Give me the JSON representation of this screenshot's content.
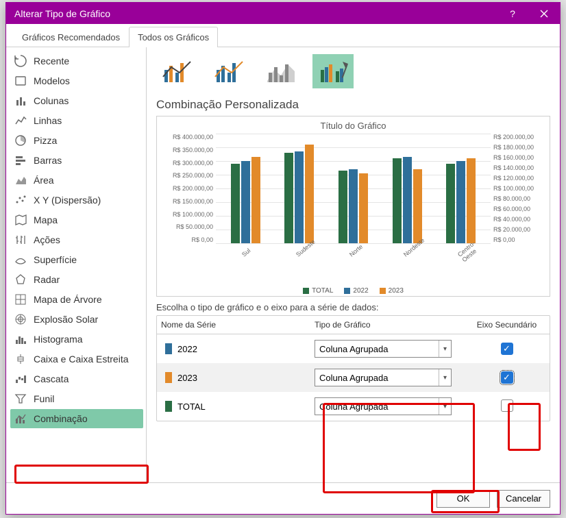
{
  "window": {
    "title": "Alterar Tipo de Gráfico"
  },
  "tabs": [
    {
      "label": "Gráficos Recomendados",
      "selected": false
    },
    {
      "label": "Todos os Gráficos",
      "selected": true
    }
  ],
  "sidebar": {
    "items": [
      {
        "label": "Recente",
        "icon": "recent"
      },
      {
        "label": "Modelos",
        "icon": "template"
      },
      {
        "label": "Colunas",
        "icon": "column"
      },
      {
        "label": "Linhas",
        "icon": "line"
      },
      {
        "label": "Pizza",
        "icon": "pie"
      },
      {
        "label": "Barras",
        "icon": "bar"
      },
      {
        "label": "Área",
        "icon": "area"
      },
      {
        "label": "X Y (Dispersão)",
        "icon": "scatter"
      },
      {
        "label": "Mapa",
        "icon": "map"
      },
      {
        "label": "Ações",
        "icon": "stock"
      },
      {
        "label": "Superfície",
        "icon": "surface"
      },
      {
        "label": "Radar",
        "icon": "radar"
      },
      {
        "label": "Mapa de Árvore",
        "icon": "treemap"
      },
      {
        "label": "Explosão Solar",
        "icon": "sunburst"
      },
      {
        "label": "Histograma",
        "icon": "histogram"
      },
      {
        "label": "Caixa e Caixa Estreita",
        "icon": "box"
      },
      {
        "label": "Cascata",
        "icon": "waterfall"
      },
      {
        "label": "Funil",
        "icon": "funnel"
      },
      {
        "label": "Combinação",
        "icon": "combo",
        "selected": true
      }
    ]
  },
  "subtypes": {
    "title": "Combinação Personalizada",
    "selected_index": 3
  },
  "chart_data": {
    "type": "bar",
    "title": "Título do Gráfico",
    "categories": [
      "Sul",
      "Sudeste",
      "Norte",
      "Nordeste",
      "Centro-Oeste"
    ],
    "series": [
      {
        "name": "TOTAL",
        "values": [
          290000,
          330000,
          265000,
          310000,
          290000
        ],
        "axis": "primary",
        "color": "#2a6e44"
      },
      {
        "name": "2022",
        "values": [
          300000,
          335000,
          270000,
          315000,
          300000
        ],
        "axis": "secondary",
        "color": "#2f6f9a"
      },
      {
        "name": "2023",
        "values": [
          315000,
          360000,
          255000,
          270000,
          310000
        ],
        "axis": "secondary",
        "color": "#e28a2a"
      }
    ],
    "ylim_primary": [
      0,
      400000
    ],
    "ylim_secondary": [
      0,
      200000
    ],
    "ylabels_primary": [
      "R$ 400.000,00",
      "R$ 350.000,00",
      "R$ 300.000,00",
      "R$ 250.000,00",
      "R$ 200.000,00",
      "R$ 150.000,00",
      "R$ 100.000,00",
      "R$ 50.000,00",
      "R$ 0,00"
    ],
    "ylabels_secondary": [
      "R$ 200.000,00",
      "R$ 180.000,00",
      "R$ 160.000,00",
      "R$ 140.000,00",
      "R$ 120.000,00",
      "R$ 100.000,00",
      "R$ 80.000,00",
      "R$ 60.000,00",
      "R$ 40.000,00",
      "R$ 20.000,00",
      "R$ 0,00"
    ]
  },
  "series_config": {
    "prompt": "Escolha o tipo de gráfico e o eixo para a série de dados:",
    "headers": {
      "name": "Nome da Série",
      "type": "Tipo de Gráfico",
      "axis": "Eixo Secundário"
    },
    "rows": [
      {
        "name": "2022",
        "color": "#2f6f9a",
        "type": "Coluna Agrupada",
        "secondary": true,
        "focused": false
      },
      {
        "name": "2023",
        "color": "#e28a2a",
        "type": "Coluna Agrupada",
        "secondary": true,
        "focused": true
      },
      {
        "name": "TOTAL",
        "color": "#2a6e44",
        "type": "Coluna Agrupada",
        "secondary": false,
        "focused": false
      }
    ]
  },
  "footer": {
    "ok": "OK",
    "cancel": "Cancelar"
  }
}
